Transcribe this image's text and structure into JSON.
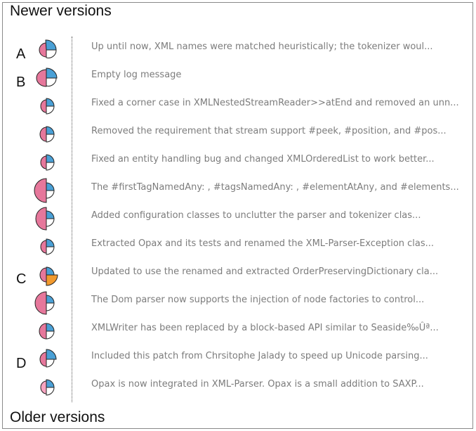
{
  "header": {
    "title": "Newer versions"
  },
  "footer": {
    "title": "Older versions"
  },
  "colors": {
    "pink": "#e6779b",
    "blue": "#4aa0d6",
    "orange": "#f29a2e",
    "light_pink": "#f7a4c0"
  },
  "versions": [
    {
      "marker": "A",
      "message": "Up until now, XML names were matched heuristically; the tokenizer woul..."
    },
    {
      "marker": "B",
      "message": "Empty log message"
    },
    {
      "marker": "",
      "message": "Fixed a corner case in XMLNestedStreamReader>>atEnd and removed an unn..."
    },
    {
      "marker": "",
      "message": "Removed the requirement that stream support #peek, #position, and #pos..."
    },
    {
      "marker": "",
      "message": "Fixed an entity handling bug and changed XMLOrderedList to work better..."
    },
    {
      "marker": "",
      "message": "The #firstTagNamedAny: , #tagsNamedAny: , #elementAtAny, and #elements..."
    },
    {
      "marker": "",
      "message": "Added configuration classes to unclutter the parser and tokenizer clas..."
    },
    {
      "marker": "",
      "message": "Extracted Opax and its tests and renamed the XML-Parser-Exception clas..."
    },
    {
      "marker": "C",
      "message": "Updated to use the renamed and extracted OrderPreservingDictionary cla..."
    },
    {
      "marker": "",
      "message": "The Dom parser now supports the injection of node factories to control..."
    },
    {
      "marker": "",
      "message": "XMLWriter has been replaced by a block-based API similar to Seaside‰Ûª..."
    },
    {
      "marker": "D",
      "message": "Included this patch from Chrsitophe Jalady to speed up Unicode parsing..."
    },
    {
      "marker": "",
      "message": "Opax is now integrated in XML-Parser. Opax is a small addition to SAXP..."
    }
  ]
}
